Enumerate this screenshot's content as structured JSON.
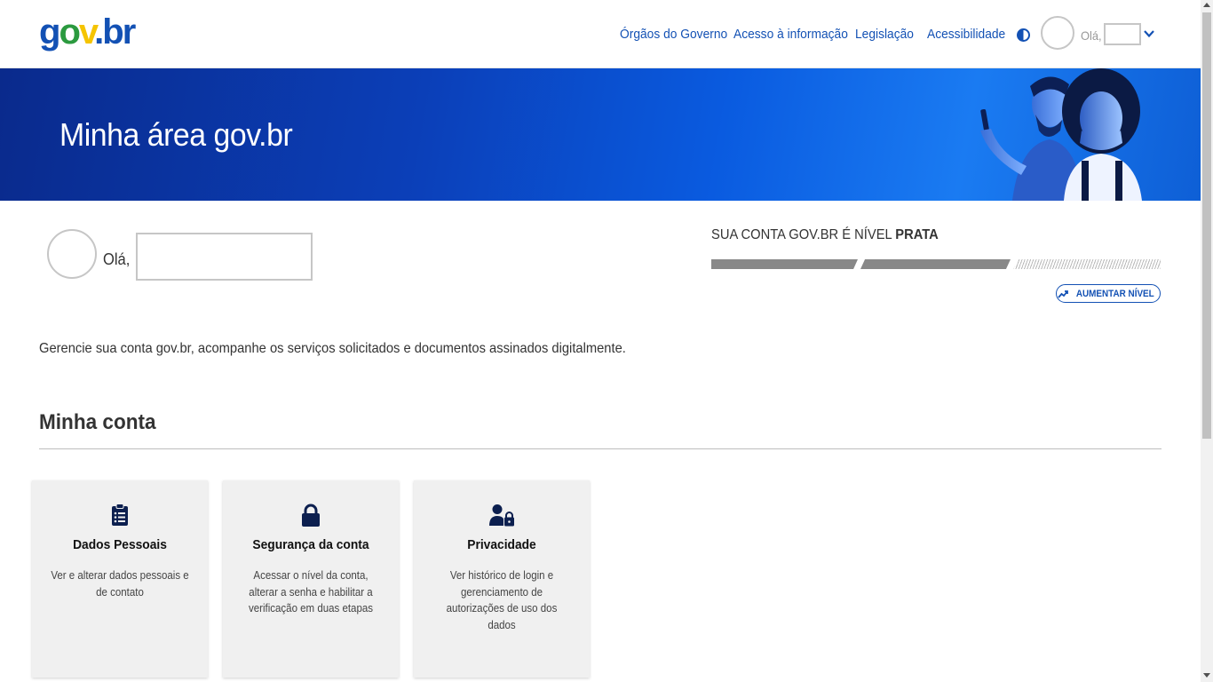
{
  "header": {
    "logo": {
      "g": "g",
      "o": "o",
      "v": "v",
      "dot": ".",
      "b": "b",
      "r": "r"
    },
    "nav": [
      {
        "label": "Órgãos do Governo"
      },
      {
        "label": "Acesso à informação"
      },
      {
        "label": "Legislação"
      },
      {
        "label": "Acessibilidade"
      }
    ],
    "greeting": "Olá,"
  },
  "banner": {
    "title": "Minha área gov.br"
  },
  "profile": {
    "greeting": "Olá,"
  },
  "level": {
    "prefix": "SUA CONTA GOV.BR É NÍVEL ",
    "value": "PRATA",
    "segments_filled": 2,
    "segments_total": 3,
    "increase_button": "AUMENTAR NÍVEL"
  },
  "description": "Gerencie sua conta gov.br, acompanhe os serviços solicitados e documentos assinados digitalmente.",
  "section": {
    "title": "Minha conta"
  },
  "cards": [
    {
      "icon": "clipboard-icon",
      "title": "Dados Pessoais",
      "text": "Ver e alterar dados pessoais e de contato"
    },
    {
      "icon": "lock-icon",
      "title": "Segurança da conta",
      "text": "Acessar o nível da conta, alterar a senha e habilitar a verificação em duas etapas"
    },
    {
      "icon": "user-lock-icon",
      "title": "Privacidade",
      "text": "Ver histórico de login e gerenciamento de autorizações de uso dos dados"
    }
  ],
  "colors": {
    "primary": "#1351b4",
    "banner_dark": "#0a2a8c",
    "banner_light": "#1a7bf2",
    "card_bg": "#f0f0f0"
  }
}
